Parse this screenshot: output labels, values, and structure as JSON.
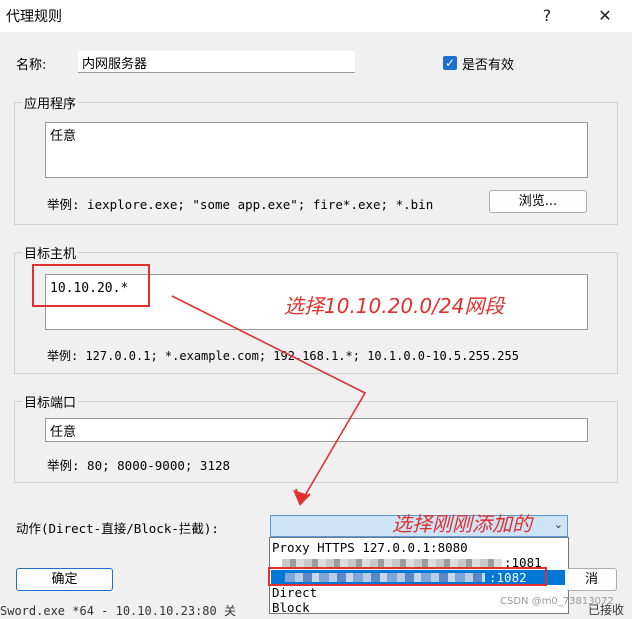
{
  "window": {
    "title": "代理规则",
    "help": "?",
    "close": "✕"
  },
  "name_field": {
    "label": "名称:",
    "value": "内网服务器"
  },
  "enabled": {
    "label": "是否有效",
    "checked": true
  },
  "app_group": {
    "legend": "应用程序",
    "value": "任意",
    "example": "举例: iexplore.exe; \"some app.exe\"; fire*.exe; *.bin",
    "browse": "浏览..."
  },
  "host_group": {
    "legend": "目标主机",
    "value": "10.10.20.*",
    "example": "举例: 127.0.0.1; *.example.com; 192.168.1.*; 10.1.0.0-10.5.255.255"
  },
  "port_group": {
    "legend": "目标端口",
    "value": "任意",
    "example": "举例: 80; 8000-9000; 3128"
  },
  "action": {
    "label": "动作(Direct-直接/Block-拦截):",
    "options": [
      "Proxy HTTPS 127.0.0.1:8080",
      ":1081",
      ":1082",
      "Direct",
      "Block"
    ],
    "selected_index": 2
  },
  "buttons": {
    "ok": "确定",
    "cancel": "消"
  },
  "annotations": {
    "host_note": "选择10.10.20.0/24网段",
    "action_note": "选择刚刚添加的"
  },
  "background_text": {
    "log": "Sword.exe *64 - 10.10.10.23:80 关",
    "right": "已接收",
    "watermark": "CSDN @m0_73813072"
  },
  "colors": {
    "accent": "#1f6fd0",
    "selection": "#0078d7",
    "annotation": "#e03030"
  }
}
